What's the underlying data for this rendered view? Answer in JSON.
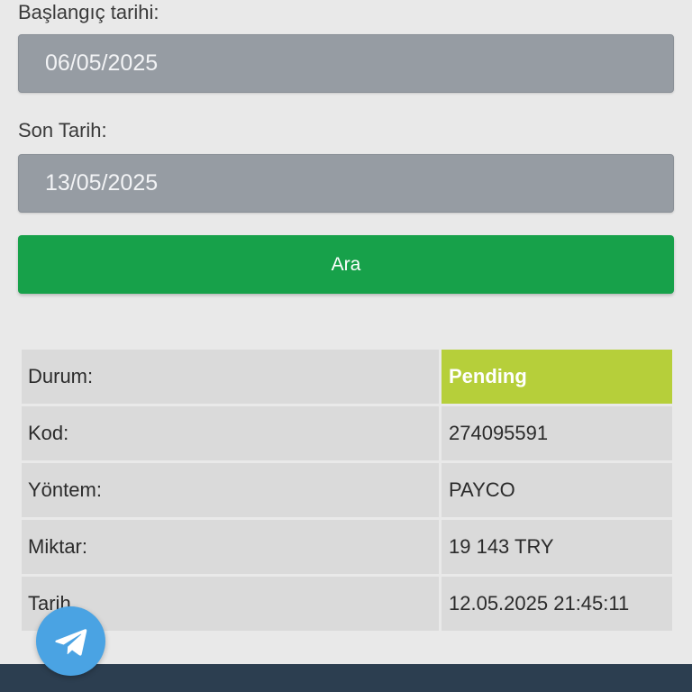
{
  "form": {
    "start_label": "Başlangıç tarihi:",
    "start_value": "06/05/2025",
    "end_label": "Son Tarih:",
    "end_value": "13/05/2025",
    "search_label": "Ara"
  },
  "details": {
    "rows": [
      {
        "label": "Durum:",
        "value": "Pending"
      },
      {
        "label": "Kod:",
        "value": "274095591"
      },
      {
        "label": "Yöntem:",
        "value": "PAYCO"
      },
      {
        "label": "Miktar:",
        "value": "19 143 TRY"
      },
      {
        "label": "Tarih",
        "value": "12.05.2025 21:45:11"
      }
    ]
  },
  "colors": {
    "status_pending": "#b6cf3a",
    "search_button": "#17a14a",
    "telegram": "#4aa3e3",
    "footer": "#2c3e50"
  },
  "floating": {
    "icon": "telegram-icon"
  }
}
